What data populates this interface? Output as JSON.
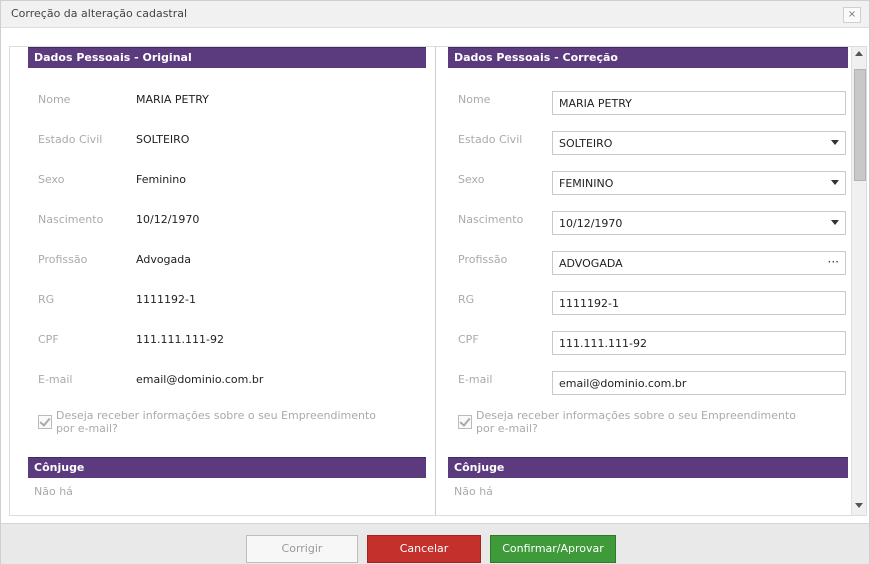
{
  "dialog": {
    "title": "Correção da alteração cadastral",
    "close_glyph": "×"
  },
  "left": {
    "header": "Dados Pessoais - Original",
    "rows": [
      {
        "label": "Nome",
        "value": "MARIA PETRY"
      },
      {
        "label": "Estado Civil",
        "value": "SOLTEIRO"
      },
      {
        "label": "Sexo",
        "value": "Feminino"
      },
      {
        "label": "Nascimento",
        "value": "10/12/1970"
      },
      {
        "label": "Profissão",
        "value": "Advogada"
      },
      {
        "label": "RG",
        "value": "1111192-1"
      },
      {
        "label": "CPF",
        "value": "111.111.111-92"
      },
      {
        "label": "E-mail",
        "value": "email@dominio.com.br"
      }
    ],
    "checkbox_text": "Deseja receber informações sobre o seu Empreendimento por e-mail?",
    "spouse_header": "Cônjuge",
    "spouse_value": "Não há"
  },
  "right": {
    "header": "Dados Pessoais - Correção",
    "rows": [
      {
        "label": "Nome",
        "value": "MARIA PETRY"
      },
      {
        "label": "Estado Civil",
        "value": "SOLTEIRO"
      },
      {
        "label": "Sexo",
        "value": "FEMININO"
      },
      {
        "label": "Nascimento",
        "value": "10/12/1970"
      },
      {
        "label": "Profissão",
        "value": "ADVOGADA"
      },
      {
        "label": "RG",
        "value": "1111192-1"
      },
      {
        "label": "CPF",
        "value": "111.111.111-92"
      },
      {
        "label": "E-mail",
        "value": "email@dominio.com.br"
      }
    ],
    "checkbox_text": "Deseja receber informações sobre o seu Empreendimento por e-mail?",
    "spouse_header": "Cônjuge",
    "spouse_value": "Não há"
  },
  "footer": {
    "corrigir": "Corrigir",
    "cancelar": "Cancelar",
    "confirmar": "Confirmar/Aprovar"
  },
  "colors": {
    "section_header": "#5b3a7d",
    "cancel": "#c4302b",
    "confirm": "#3f9a3a"
  },
  "icons": {
    "close": "close-icon",
    "dropdown": "chevron-down-icon",
    "more": "ellipsis-icon",
    "check": "checkmark-icon",
    "scroll_up": "scroll-up-icon",
    "scroll_down": "scroll-down-icon"
  }
}
